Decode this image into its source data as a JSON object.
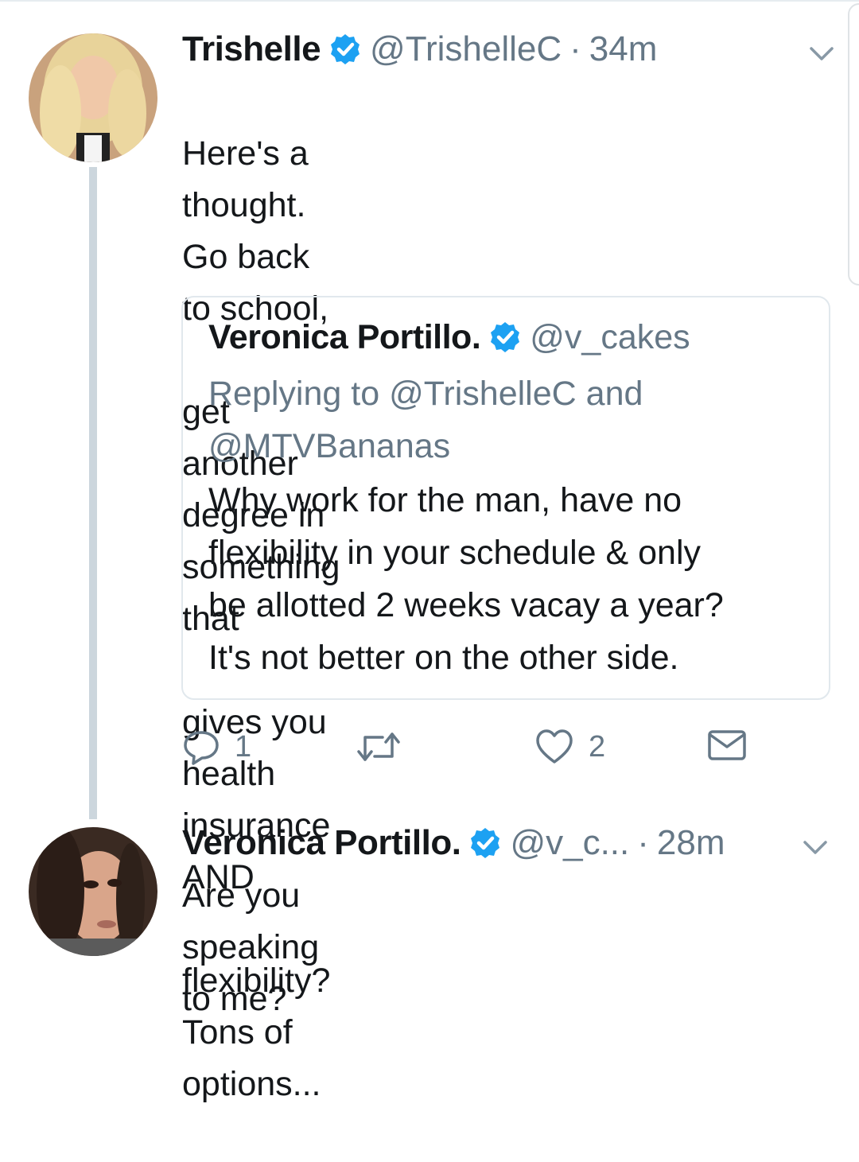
{
  "tweet_main": {
    "name": "Trishelle",
    "handle": "@TrishelleC",
    "separator": "·",
    "time": "34m",
    "text_lines": [
      "Here's a thought. Go back to school,",
      "get another degree in something that",
      "gives you health insurance AND",
      "flexibility? Tons of options..."
    ]
  },
  "quoted_tweet": {
    "name": "Veronica Portillo.",
    "handle": "@v_cakes",
    "replying_prefix": "Replying to",
    "replying_mention_1": "@TrishelleC",
    "replying_and": "and",
    "replying_mention_2": "@MTVBananas",
    "text_lines": [
      "Why work for the man, have no",
      "flexibility in your schedule & only",
      "be allotted 2 weeks vacay a year?",
      "It's not better on the other side."
    ]
  },
  "actions": {
    "reply_count": "1",
    "retweet_count": "",
    "like_count": "2"
  },
  "tweet_reply": {
    "name": "Veronica Portillo.",
    "handle": "@v_c...",
    "separator": "·",
    "time": "28m",
    "text": "Are you speaking to me?"
  },
  "colors": {
    "text": "#14171a",
    "secondary": "#657786",
    "verified": "#1da1f2",
    "thread_line": "#ccd6dd",
    "card_border": "#e1e8ed"
  },
  "icons": [
    "verified-badge-icon",
    "chevron-down-icon",
    "reply-icon",
    "retweet-icon",
    "like-icon",
    "direct-message-icon"
  ]
}
